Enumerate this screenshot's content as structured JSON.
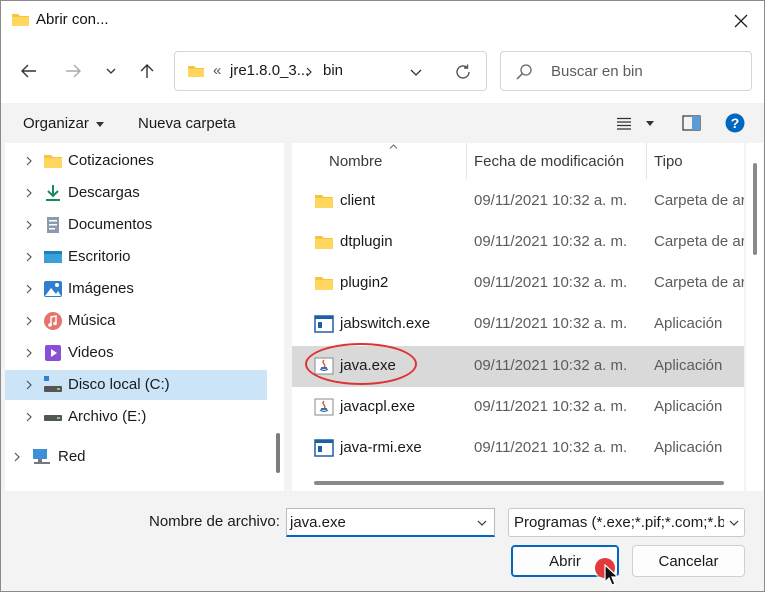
{
  "window": {
    "title": "Abrir con..."
  },
  "nav": {
    "address": {
      "overflow": "«",
      "segments": [
        "jre1.8.0_3...",
        "bin"
      ]
    },
    "search": {
      "placeholder": "Buscar en bin"
    }
  },
  "commandbar": {
    "organize": "Organizar",
    "new_folder": "Nueva carpeta"
  },
  "tree": [
    {
      "label": "Cotizaciones",
      "icon": "folder-icon",
      "expandable": true,
      "selected": false
    },
    {
      "label": "Descargas",
      "icon": "download-icon",
      "expandable": true,
      "selected": false
    },
    {
      "label": "Documentos",
      "icon": "documents-icon",
      "expandable": true,
      "selected": false
    },
    {
      "label": "Escritorio",
      "icon": "desktop-icon",
      "expandable": true,
      "selected": false
    },
    {
      "label": "Imágenes",
      "icon": "pictures-icon",
      "expandable": true,
      "selected": false
    },
    {
      "label": "Música",
      "icon": "music-icon",
      "expandable": true,
      "selected": false
    },
    {
      "label": "Videos",
      "icon": "videos-icon",
      "expandable": true,
      "selected": false
    },
    {
      "label": "Disco local (C:)",
      "icon": "drive-icon",
      "expandable": true,
      "selected": true
    },
    {
      "label": "Archivo (E:)",
      "icon": "drive-icon",
      "expandable": true,
      "selected": false
    },
    {
      "label": "Red",
      "icon": "network-icon",
      "expandable": true,
      "selected": false
    }
  ],
  "columns": {
    "name": "Nombre",
    "modified": "Fecha de modificación",
    "type": "Tipo"
  },
  "files": [
    {
      "name": "client",
      "icon": "folder-icon",
      "modified": "09/11/2021 10:32 a. m.",
      "type": "Carpeta de archivos",
      "selected": false
    },
    {
      "name": "dtplugin",
      "icon": "folder-icon",
      "modified": "09/11/2021 10:32 a. m.",
      "type": "Carpeta de archivos",
      "selected": false
    },
    {
      "name": "plugin2",
      "icon": "folder-icon",
      "modified": "09/11/2021 10:32 a. m.",
      "type": "Carpeta de archivos",
      "selected": false
    },
    {
      "name": "jabswitch.exe",
      "icon": "app-icon",
      "modified": "09/11/2021 10:32 a. m.",
      "type": "Aplicación",
      "selected": false
    },
    {
      "name": "java.exe",
      "icon": "java-icon",
      "modified": "09/11/2021 10:32 a. m.",
      "type": "Aplicación",
      "selected": true
    },
    {
      "name": "javacpl.exe",
      "icon": "java-icon",
      "modified": "09/11/2021 10:32 a. m.",
      "type": "Aplicación",
      "selected": false
    },
    {
      "name": "java-rmi.exe",
      "icon": "app-icon",
      "modified": "09/11/2021 10:32 a. m.",
      "type": "Aplicación",
      "selected": false
    }
  ],
  "footer": {
    "filename_label": "Nombre de archivo:",
    "filename_value": "java.exe",
    "filetype_value": "Programas (*.exe;*.pif;*.com;*.bat;*.cmd)",
    "open_label": "Abrir",
    "cancel_label": "Cancelar"
  },
  "colors": {
    "accent": "#0067c0",
    "selection": "#cce4f7",
    "row_selected": "#d9d9d9",
    "annotation": "#dd3333"
  }
}
